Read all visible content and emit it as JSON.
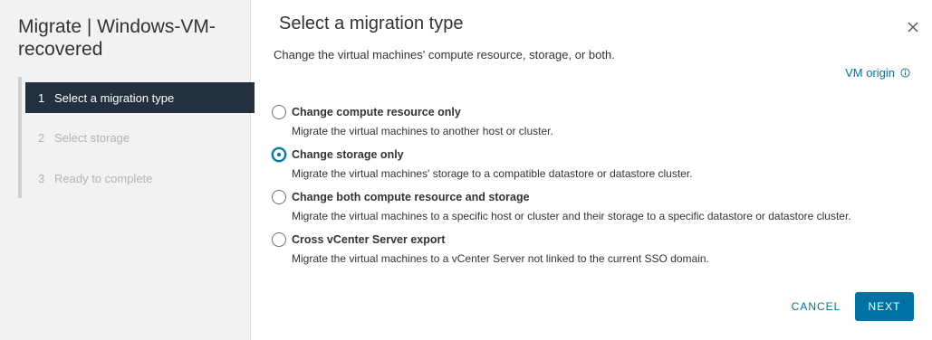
{
  "wizard": {
    "title": "Migrate | Windows-VM-recovered",
    "steps": [
      {
        "number": "1",
        "label": "Select a migration type",
        "active": true
      },
      {
        "number": "2",
        "label": "Select storage",
        "active": false
      },
      {
        "number": "3",
        "label": "Ready to complete",
        "active": false
      }
    ]
  },
  "main": {
    "title": "Select a migration type",
    "subtitle": "Change the virtual machines' compute resource, storage, or both.",
    "vm_origin_link": "VM origin",
    "close_icon": "close-icon",
    "info_icon": "info-icon",
    "options": [
      {
        "label": "Change compute resource only",
        "description": "Migrate the virtual machines to another host or cluster.",
        "selected": false
      },
      {
        "label": "Change storage only",
        "description": "Migrate the virtual machines' storage to a compatible datastore or datastore cluster.",
        "selected": true
      },
      {
        "label": "Change both compute resource and storage",
        "description": "Migrate the virtual machines to a specific host or cluster and their storage to a specific datastore or datastore cluster.",
        "selected": false
      },
      {
        "label": "Cross vCenter Server export",
        "description": "Migrate the virtual machines to a vCenter Server not linked to the current SSO domain.",
        "selected": false
      }
    ]
  },
  "footer": {
    "cancel_label": "CANCEL",
    "next_label": "NEXT"
  },
  "colors": {
    "accent": "#0072a3",
    "active_step_bg": "#23313f",
    "sidebar_bg": "#f2f2f2"
  }
}
